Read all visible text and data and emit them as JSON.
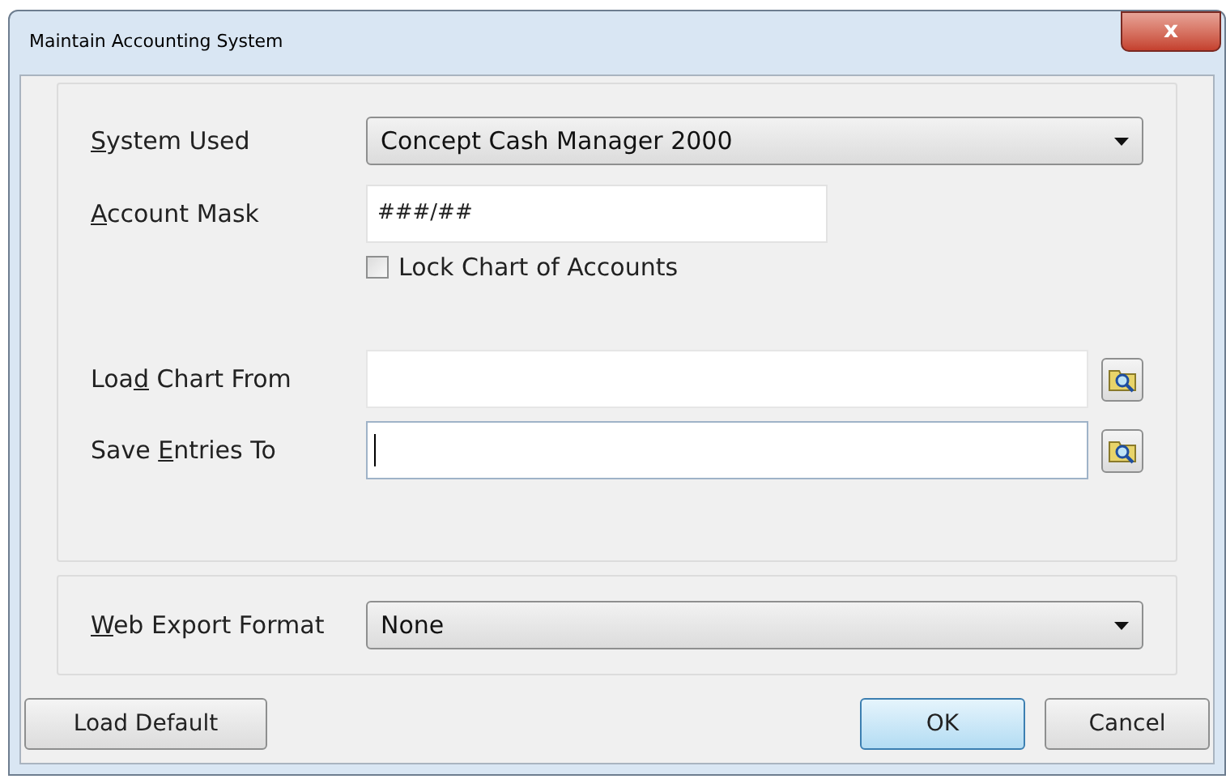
{
  "window": {
    "title": "Maintain Accounting System",
    "close": "x"
  },
  "fields": [
    {
      "kind": "dropdown",
      "label": {
        "key": "S",
        "after": "ystem Used"
      },
      "value": "Concept Cash Manager 2000"
    },
    {
      "kind": "mask",
      "label": {
        "key": "A",
        "after": "ccount Mask"
      },
      "value": "###/##"
    },
    {
      "kind": "checkbox",
      "label": "Lock Chart of Accounts",
      "checked": false
    },
    {
      "kind": "path",
      "label": {
        "before": "Loa",
        "key": "d",
        "after": " Chart From"
      },
      "focused": false
    },
    {
      "kind": "path",
      "label": {
        "before": "Save ",
        "key": "E",
        "after": "ntries To"
      },
      "focused": true
    }
  ],
  "export": {
    "label": {
      "key": "W",
      "after": "eb Export Format"
    },
    "value": "None"
  },
  "buttons": [
    {
      "label": "Load Default",
      "default": false
    },
    {
      "label": "OK",
      "default": true
    },
    {
      "label": "Cancel",
      "default": false
    }
  ]
}
